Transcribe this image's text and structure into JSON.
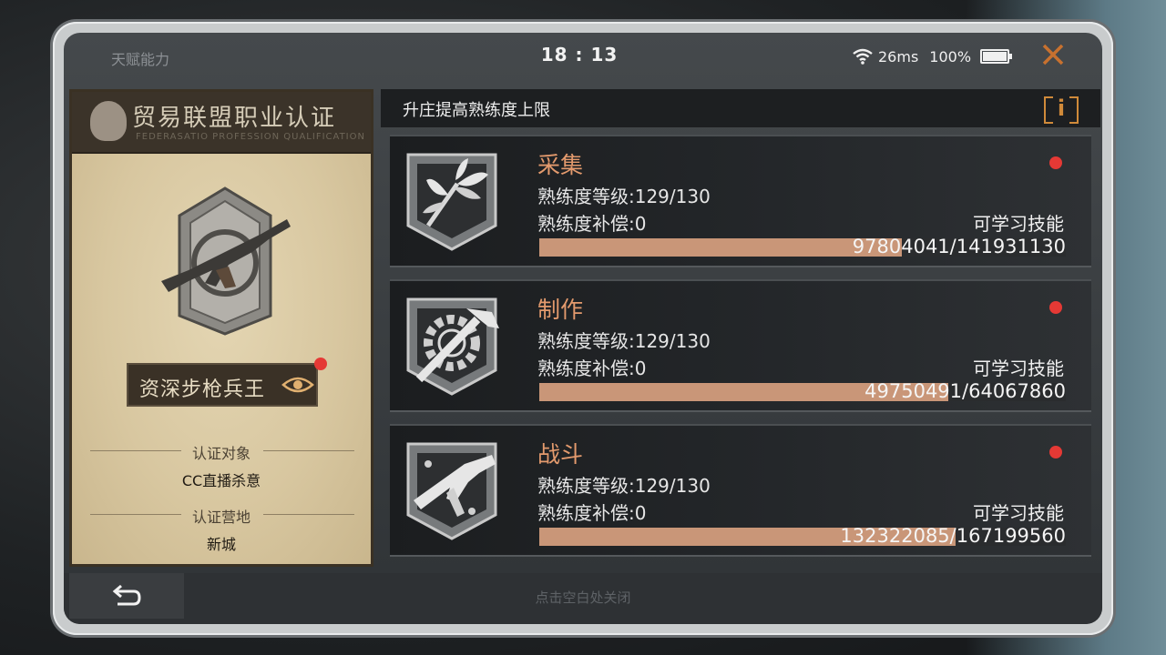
{
  "status_bar": {
    "title": "天赋能力",
    "time": "18 : 13",
    "ping": "26ms",
    "battery": "100%",
    "close_icon": "close-icon"
  },
  "certificate": {
    "title": "贸易联盟职业认证",
    "subtitle": "FEDERASATIO PROFESSION QUALIFICATION",
    "rank": "资深步枪兵王",
    "target_label": "认证对象",
    "target_value": "CC直播杀意",
    "camp_label": "认证营地",
    "camp_value": "新城"
  },
  "panel": {
    "title": "升庄提高熟练度上限",
    "info_label": "i"
  },
  "skills": [
    {
      "name": "采集",
      "level": "熟练度等级:129/130",
      "compensation": "熟练度补偿:0",
      "learnable": "可学习技能",
      "progress_text": "97804041/141931130",
      "progress": 0.689,
      "icon": "herb-icon"
    },
    {
      "name": "制作",
      "level": "熟练度等级:129/130",
      "compensation": "熟练度补偿:0",
      "learnable": "可学习技能",
      "progress_text": "49750491/64067860",
      "progress": 0.777,
      "icon": "wrench-gear-icon"
    },
    {
      "name": "战斗",
      "level": "熟练度等级:129/130",
      "compensation": "熟练度补偿:0",
      "learnable": "可学习技能",
      "progress_text": "132322085/167199560",
      "progress": 0.791,
      "icon": "smg-icon"
    }
  ],
  "bottom": {
    "back_icon": "back-arrow-icon",
    "hint": "点击空白处关闭"
  },
  "colors": {
    "accent": "#e39a6d",
    "progress_fill": "#c99678",
    "notification": "#e53935"
  }
}
